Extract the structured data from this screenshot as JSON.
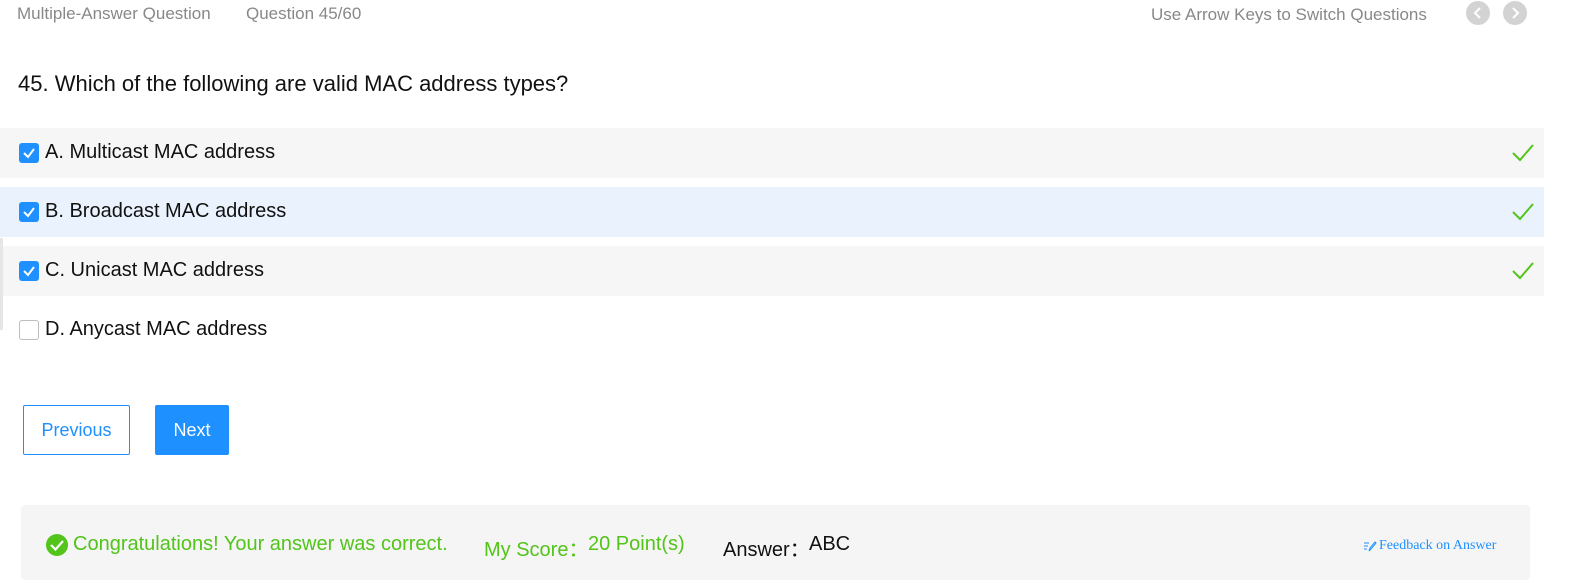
{
  "header": {
    "question_type": "Multiple-Answer Question",
    "question_counter": "Question 45/60",
    "hint": "Use Arrow Keys to Switch Questions",
    "prev_icon": "chevron-left-icon",
    "next_icon": "chevron-right-icon"
  },
  "question": {
    "text": "45. Which of the following are valid MAC address types?"
  },
  "options": [
    {
      "label": "A. Multicast MAC address",
      "checked": true,
      "correct": true
    },
    {
      "label": "B. Broadcast MAC address",
      "checked": true,
      "correct": true
    },
    {
      "label": "C. Unicast MAC address",
      "checked": true,
      "correct": true
    },
    {
      "label": "D. Anycast MAC address",
      "checked": false,
      "correct": false
    }
  ],
  "buttons": {
    "previous": "Previous",
    "next": "Next"
  },
  "result": {
    "message": "Congratulations! Your answer was correct.",
    "score_label": "My Score：",
    "score_value": "20 Point(s)",
    "answer_label": "Answer：",
    "answer_value": "ABC",
    "feedback": "Feedback on Answer"
  },
  "colors": {
    "accent": "#1e90ff",
    "success": "#52c41a",
    "selected_row": "#eaf3fd"
  }
}
